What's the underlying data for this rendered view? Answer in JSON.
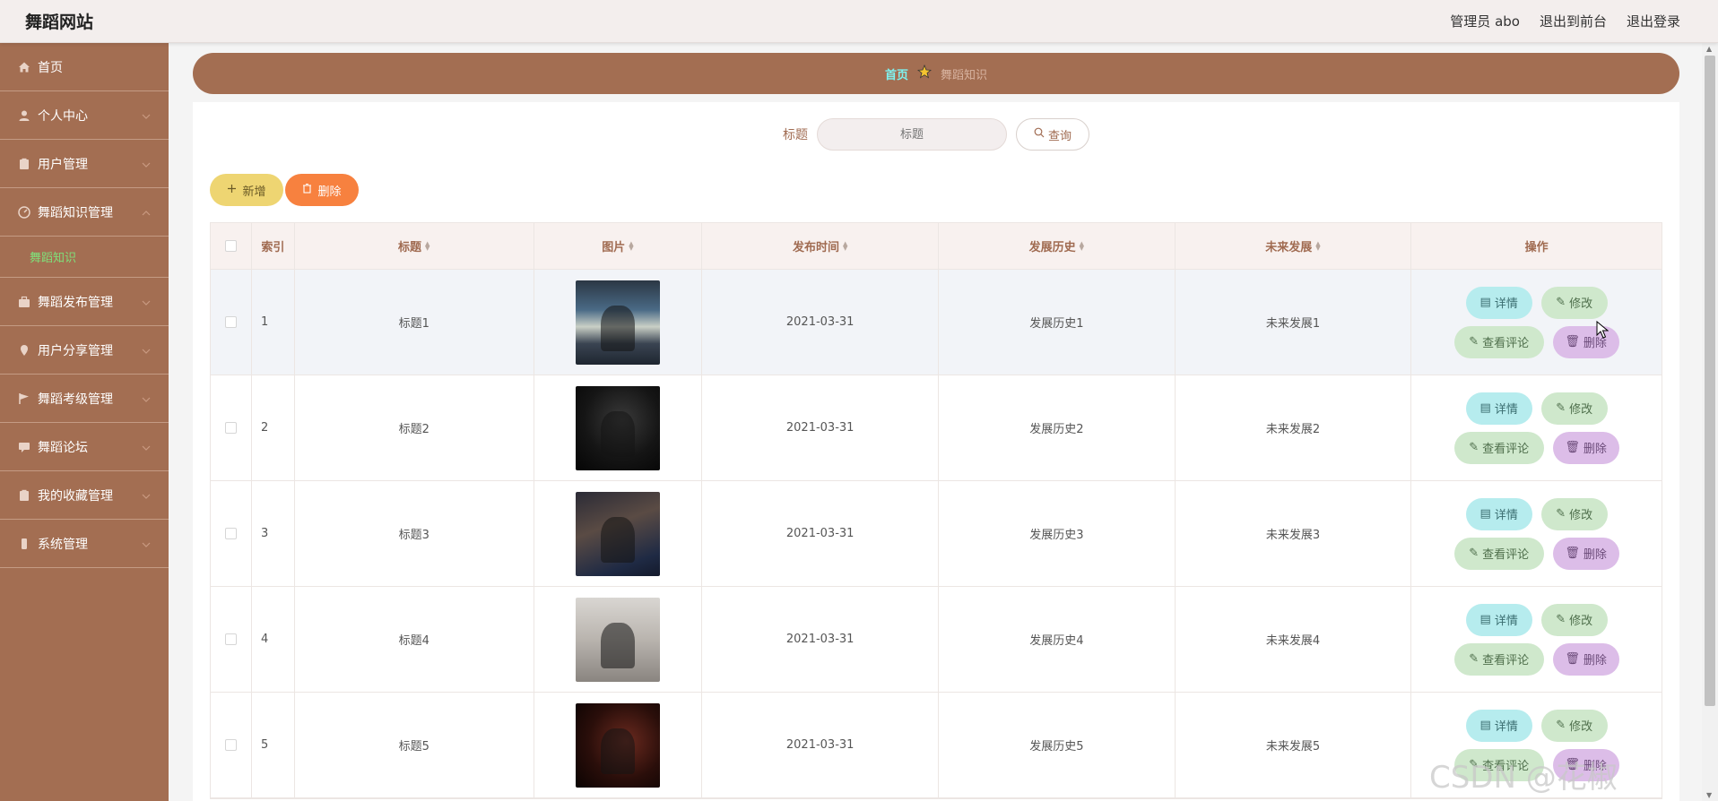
{
  "header": {
    "site_title": "舞蹈网站",
    "admin": "管理员 abo",
    "exit_front": "退出到前台",
    "logout": "退出登录"
  },
  "sidebar": {
    "items": [
      {
        "label": "首页",
        "icon": "home-icon"
      },
      {
        "label": "个人中心",
        "icon": "user-icon"
      },
      {
        "label": "用户管理",
        "icon": "clipboard-icon"
      },
      {
        "label": "舞蹈知识管理",
        "icon": "dashboard-icon"
      },
      {
        "label": "舞蹈发布管理",
        "icon": "briefcase-icon"
      },
      {
        "label": "用户分享管理",
        "icon": "location-icon"
      },
      {
        "label": "舞蹈考级管理",
        "icon": "flag-icon"
      },
      {
        "label": "舞蹈论坛",
        "icon": "chat-icon"
      },
      {
        "label": "我的收藏管理",
        "icon": "clipboard-icon"
      },
      {
        "label": "系统管理",
        "icon": "phone-icon"
      }
    ],
    "sub_item": "舞蹈知识"
  },
  "breadcrumb": {
    "home": "首页",
    "current": "舞蹈知识"
  },
  "search": {
    "label": "标题",
    "placeholder": "标题",
    "button": "查询"
  },
  "actions": {
    "add": "新增",
    "delete": "删除"
  },
  "table": {
    "headers": [
      "索引",
      "标题",
      "图片",
      "发布时间",
      "发展历史",
      "未来发展",
      "操作"
    ],
    "rows": [
      {
        "index": "1",
        "title": "标题1",
        "date": "2021-03-31",
        "history": "发展历史1",
        "future": "未来发展1"
      },
      {
        "index": "2",
        "title": "标题2",
        "date": "2021-03-31",
        "history": "发展历史2",
        "future": "未来发展2"
      },
      {
        "index": "3",
        "title": "标题3",
        "date": "2021-03-31",
        "history": "发展历史3",
        "future": "未来发展3"
      },
      {
        "index": "4",
        "title": "标题4",
        "date": "2021-03-31",
        "history": "发展历史4",
        "future": "未来发展4"
      },
      {
        "index": "5",
        "title": "标题5",
        "date": "2021-03-31",
        "history": "发展历史5",
        "future": "未来发展5"
      }
    ],
    "ops": {
      "detail": "详情",
      "edit": "修改",
      "comment": "查看评论",
      "delete": "删除"
    }
  },
  "watermark": "CSDN @花椒coding",
  "colors": {
    "sidebar": "#a36e52",
    "breadcrumb_home": "#7ef3f0",
    "sub_item": "#7fe07a",
    "add_button": "#eed572",
    "delete_button": "#f7813f"
  }
}
